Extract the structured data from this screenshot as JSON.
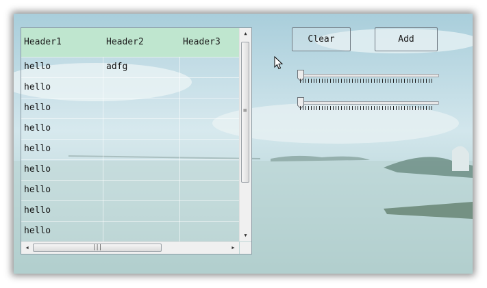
{
  "table": {
    "headers": [
      "Header1",
      "Header2",
      "Header3"
    ],
    "rows": [
      [
        "hello",
        "adfg",
        ""
      ],
      [
        "hello",
        "",
        ""
      ],
      [
        "hello",
        "",
        ""
      ],
      [
        "hello",
        "",
        ""
      ],
      [
        "hello",
        "",
        ""
      ],
      [
        "hello",
        "",
        ""
      ],
      [
        "hello",
        "",
        ""
      ],
      [
        "hello",
        "",
        ""
      ],
      [
        "hello",
        "",
        ""
      ]
    ]
  },
  "buttons": {
    "clear_label": "Clear",
    "add_label": "Add"
  },
  "sliders": [
    {
      "value": 0
    },
    {
      "value": 0
    }
  ],
  "icons": {
    "cursor": "mouse-pointer-icon",
    "scroll_up": "arrow-up-icon",
    "scroll_down": "arrow-down-icon",
    "scroll_left": "arrow-left-icon",
    "scroll_right": "arrow-right-icon"
  }
}
